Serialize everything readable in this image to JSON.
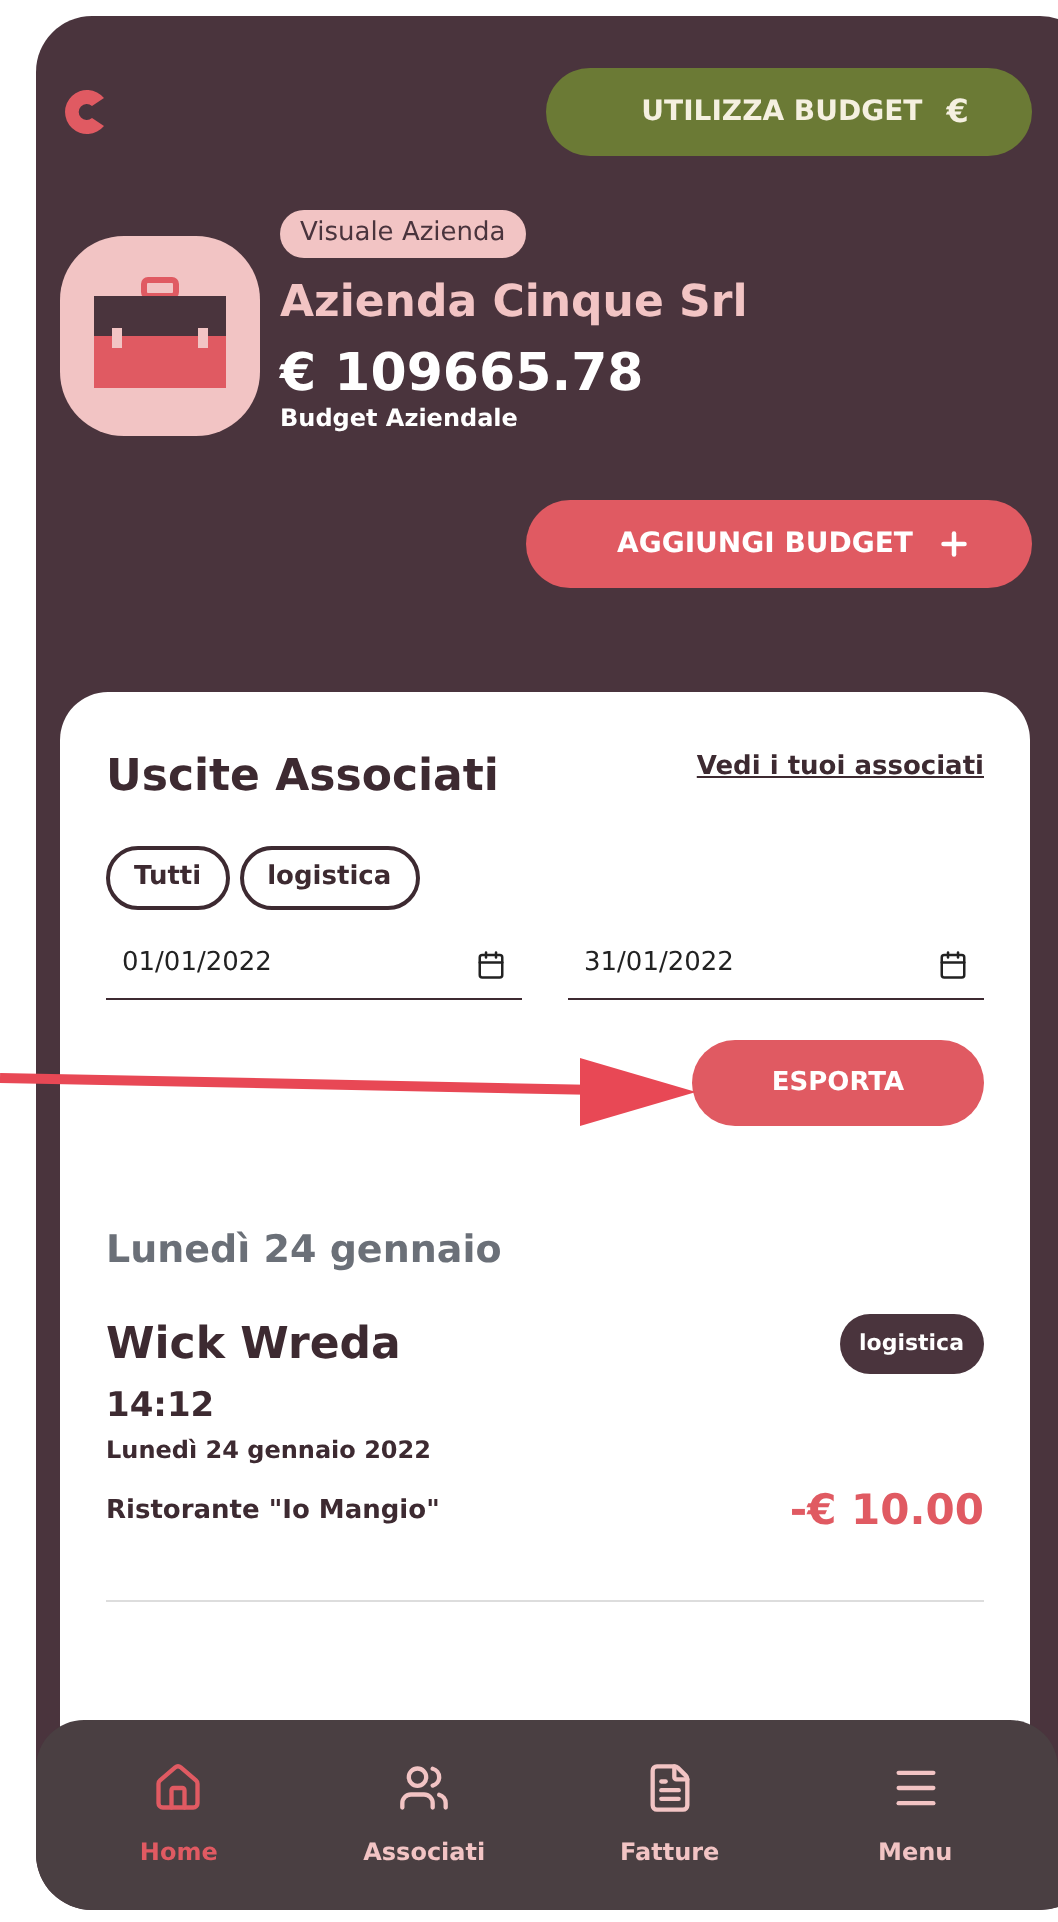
{
  "header": {
    "use_budget_button": {
      "label": "UTILIZZA BUDGET",
      "symbol": "€"
    }
  },
  "company": {
    "badge": "Visuale Azienda",
    "name": "Azienda Cinque Srl",
    "amount": "€ 109665.78",
    "amount_caption": "Budget Aziendale"
  },
  "add_budget_button": {
    "label": "AGGIUNGI BUDGET"
  },
  "expenses": {
    "title": "Uscite Associati",
    "link": "Vedi i tuoi associati",
    "filters": [
      {
        "label": "Tutti"
      },
      {
        "label": "logistica"
      }
    ],
    "date_from": "01/01/2022",
    "date_to": "31/01/2022",
    "export_button": "ESPORTA",
    "groups": [
      {
        "heading": "Lunedì 24 gennaio",
        "entries": [
          {
            "name": "Wick Wreda",
            "tag": "logistica",
            "time": "14:12",
            "date": "Lunedì 24 gennaio 2022",
            "place": "Ristorante \"Io Mangio\"",
            "amount": "-€ 10.00"
          }
        ]
      }
    ]
  },
  "nav": [
    {
      "label": "Home",
      "kind": "home",
      "selected": true
    },
    {
      "label": "Associati",
      "kind": "people",
      "selected": false
    },
    {
      "label": "Fatture",
      "kind": "invoices",
      "selected": false
    },
    {
      "label": "Menu",
      "kind": "menu",
      "selected": false
    }
  ]
}
